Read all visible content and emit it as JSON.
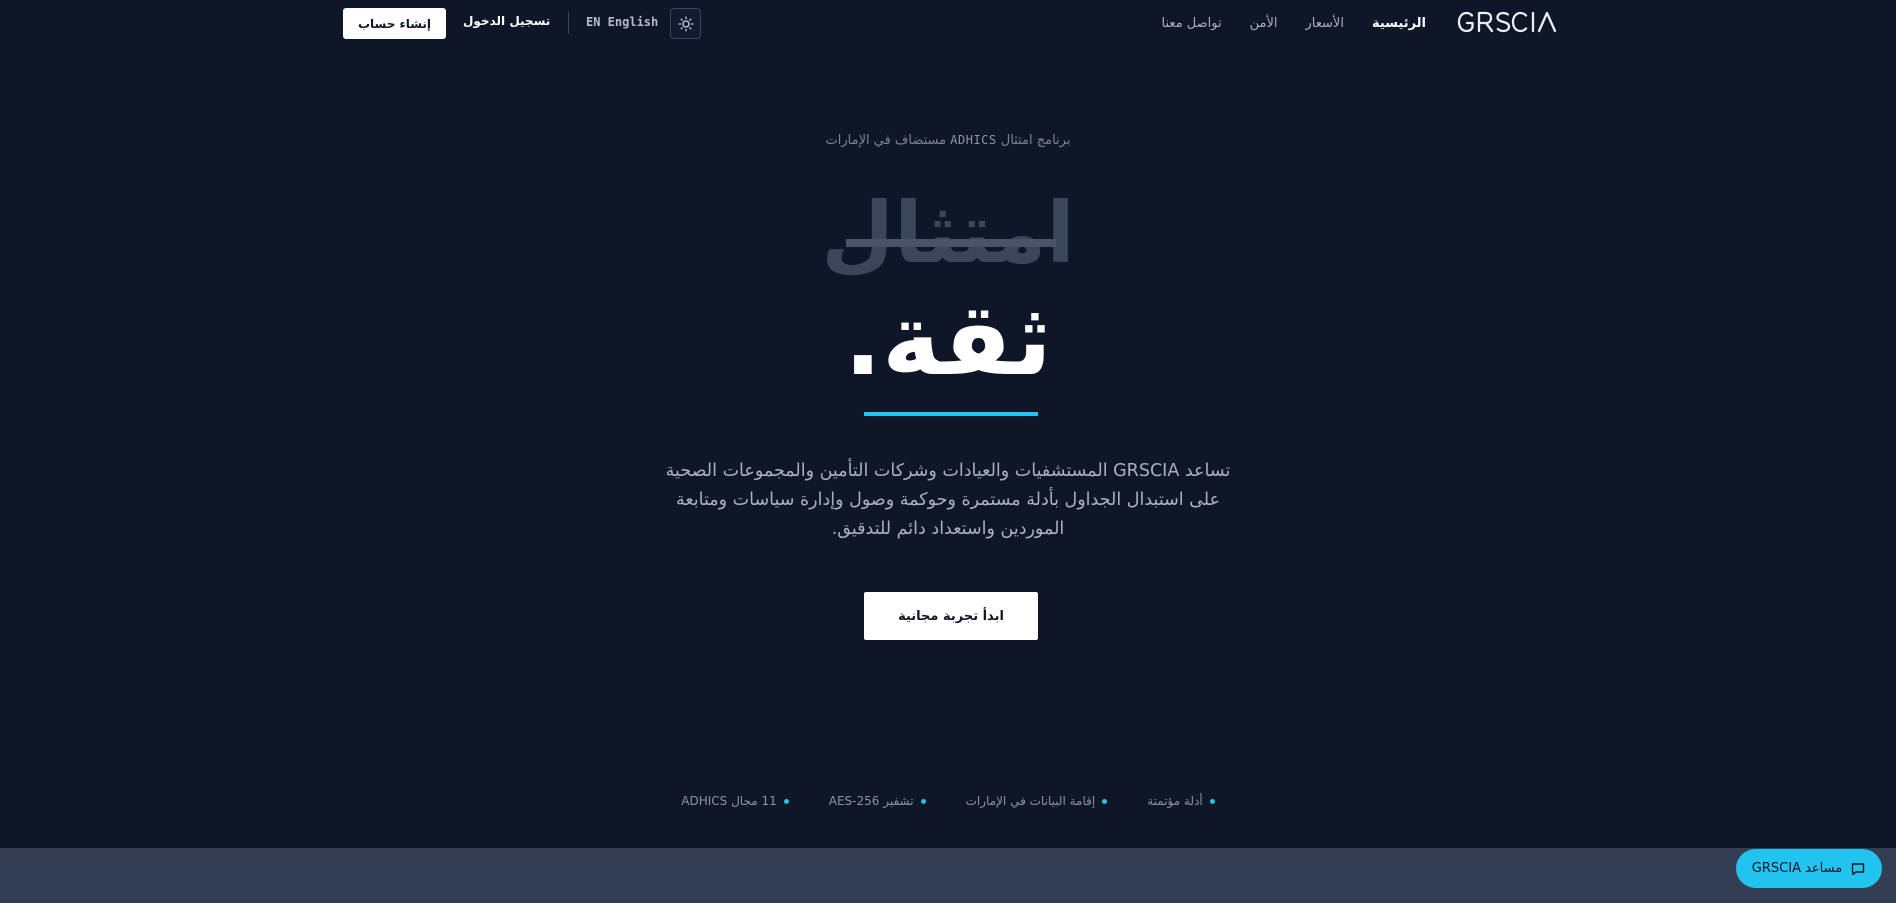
{
  "header": {
    "logo": "GRSCIA",
    "nav": [
      {
        "label": "الرئيسية",
        "active": true
      },
      {
        "label": "الأسعار",
        "active": false
      },
      {
        "label": "الأمن",
        "active": false
      },
      {
        "label": "تواصل معنا",
        "active": false
      }
    ],
    "language": "EN English",
    "login_label": "تسجيل الدخول",
    "signup_label": "إنشاء حساب",
    "theme_icon": "sun-icon"
  },
  "hero": {
    "eyebrow_start": "برنامج امتثال",
    "eyebrow_code": "ADHICS",
    "eyebrow_end": "مستضاف في الإمارات",
    "struck_word": "امتثال",
    "main_word": "ثقة.",
    "description": "تساعد GRSCIA المستشفيات والعيادات وشركات التأمين والمجموعات الصحية على استبدال الجداول بأدلة مستمرة وحوكمة وصول وإدارة سياسات ومتابعة الموردين واستعداد دائم للتدقيق.",
    "cta_label": "ابدأ تجربة مجانية"
  },
  "features": [
    "11 مجال ADHICS",
    "تشفير AES-256",
    "إقامة البيانات في الإمارات",
    "أدلة مؤتمتة"
  ],
  "assistant": {
    "label": "مساعد GRSCIA",
    "icon": "chat-bubble-icon"
  },
  "colors": {
    "background": "#0e1628",
    "accent": "#22c3ee",
    "band": "#323f52"
  }
}
